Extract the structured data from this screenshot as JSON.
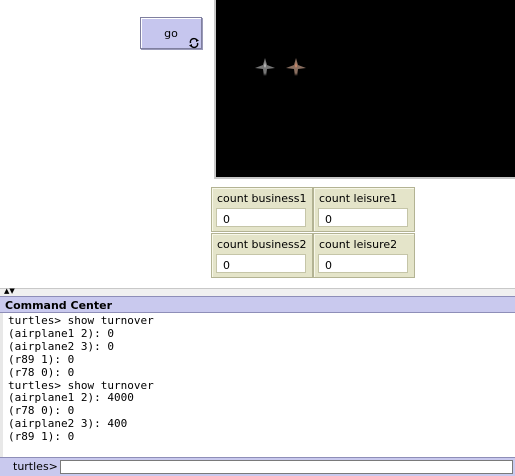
{
  "interface": {
    "go_button": {
      "label": "go",
      "icon": "forever-loop-icon"
    },
    "monitors": [
      {
        "label": "count business1",
        "value": "0"
      },
      {
        "label": "count leisure1",
        "value": "0"
      },
      {
        "label": "count business2",
        "value": "0"
      },
      {
        "label": "count leisure2",
        "value": "0"
      }
    ],
    "world": {
      "background": "#000000",
      "turtle_icons": [
        "airplane-icon",
        "airplane-icon"
      ]
    }
  },
  "command_center": {
    "title": "Command Center",
    "output": "turtles> show turnover\n(airplane1 2): 0\n(airplane2 3): 0\n(r89 1): 0\n(r78 0): 0\nturtles> show turnover\n(airplane1 2): 4000\n(r78 0): 0\n(airplane2 3): 400\n(r89 1): 0",
    "agent_selector": "turtles>",
    "input_value": ""
  },
  "colors": {
    "button_bg": "#c6c6ee",
    "monitor_bg": "#e4e4c9",
    "header_bg": "#c9c9ee"
  }
}
